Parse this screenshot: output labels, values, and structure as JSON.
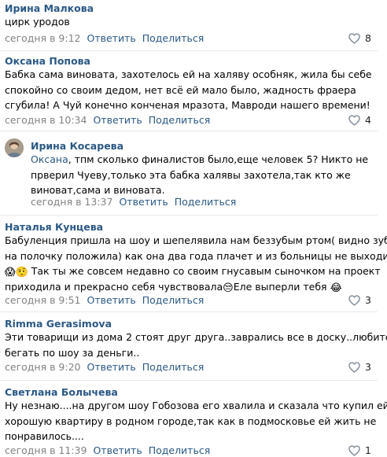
{
  "comments": [
    {
      "author": "Ирина Малкова",
      "lines": [
        "цирк уродов"
      ],
      "date": "сегодня в 9:12",
      "reply": "Ответить",
      "share": "Поделиться",
      "likes": "8"
    },
    {
      "author": "Оксана Попова",
      "lines": [
        "Бабка сама виновата, захотелось ей на халяву особняк, жила бы себе",
        "спокойно со своим дедом, нет всё ей мало было, жадность фраера",
        "сгубила! А Чуй конечно конченая мразота, Мавроди нашего времени!"
      ],
      "date": "сегодня в 10:34",
      "reply": "Ответить",
      "share": "Поделиться",
      "likes": "4"
    },
    {
      "author": "Ирина Косарева",
      "reply_to": "Оксана",
      "lines": [
        ", тпм сколько финалистов было,еще человек 5? Никто не",
        "прверил Чуеву,только эта бабка халявы захотела,так кто же",
        "виноват,сама и виновата."
      ],
      "date": "сегодня в 13:37",
      "reply": "Ответить",
      "share": "Поделиться"
    },
    {
      "author": "Наталья Кунцева",
      "lines": [
        "Бабуленция пришла на шоу и шепелявила нам беззубым ртом( видно зубы",
        "на полочку положила) как она два года плачет и из больницы не выходит",
        " Так ты же совсем недавно со своим гнусавым сыночком на проект",
        "приходила и прекрасно себя чувствовала",
        "Еле выперли тебя "
      ],
      "emoji": [
        "😱",
        "🤨",
        "😒",
        "😂"
      ],
      "date": "сегодня в 9:51",
      "reply": "Ответить",
      "share": "Поделиться",
      "likes": "3"
    },
    {
      "author": "Rimma Gerasimova",
      "lines": [
        "Эти товарищи из дома 2 стоят друг друга..заврались все в доску..любители",
        "бегать по шоу за деньги.."
      ],
      "date": "сегодня в 9:20",
      "reply": "Ответить",
      "share": "Поделиться",
      "likes": "3"
    },
    {
      "author": "Светлана Болычева",
      "lines": [
        "Ну незнаю....на другом шоу Гобозова его хвалила и сказала что купил ей",
        "хорошую квартиру в родном городе,так как в подмосковье ей жить не",
        "понравилось...."
      ],
      "date": "сегодня в 11:39",
      "reply": "Ответить",
      "share": "Поделиться",
      "likes": "1"
    }
  ],
  "colors": {
    "link": "#2a5885",
    "muted": "#828282",
    "divider": "#e7e8ec",
    "heart_stroke": "#7f8b97"
  },
  "icons": {
    "like": "heart-icon",
    "avatar": "user-photo"
  }
}
